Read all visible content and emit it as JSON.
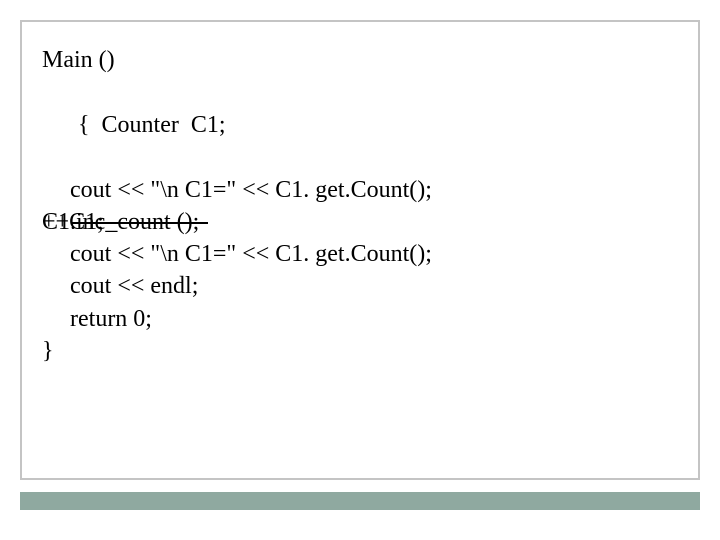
{
  "code": {
    "line1": "Main ()",
    "line2_open": "{",
    "line2_decl": "  Counter  C1;",
    "line3": "cout << \"\\n C1=\" << C1. get.Count();",
    "line4_original": "C1.inc_count ();",
    "line4_replacement": "++C1;",
    "line5": "cout << \"\\n C1=\" << C1. get.Count();",
    "line6": "cout << endl;",
    "line7": "return 0;",
    "line8": "}"
  }
}
